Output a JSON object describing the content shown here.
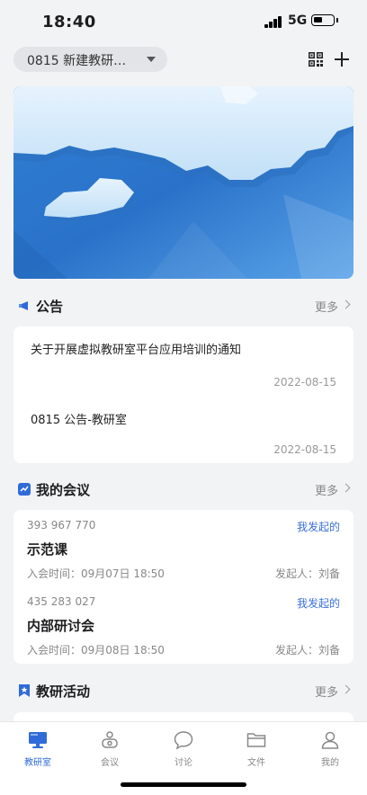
{
  "status_bar": {
    "time": "18:40",
    "network": "5G"
  },
  "header": {
    "room_name": "0815 新建教研…",
    "qr_icon": "qr-code-icon",
    "add_icon": "plus-icon"
  },
  "banner": {
    "image": "blue-hexagon-banner"
  },
  "announcements": {
    "title": "公告",
    "more": "更多",
    "items": [
      {
        "title": "关于开展虚拟教研室平台应用培训的通知",
        "date": "2022-08-15"
      },
      {
        "title": "0815 公告-教研室",
        "date": "2022-08-15"
      }
    ]
  },
  "meetings": {
    "title": "我的会议",
    "more": "更多",
    "items": [
      {
        "id": "393 967 770",
        "tag": "我发起的",
        "name": "示范课",
        "time": "入会时间：09月07日 18:50",
        "host": "发起人：刘备"
      },
      {
        "id": "435 283 027",
        "tag": "我发起的",
        "name": "内部研讨会",
        "time": "入会时间：09月08日 18:50",
        "host": "发起人：刘备"
      }
    ]
  },
  "activities": {
    "title": "教研活动",
    "more": "更多"
  },
  "tabbar": {
    "items": [
      {
        "label": "教研室",
        "active": true
      },
      {
        "label": "会议"
      },
      {
        "label": "讨论"
      },
      {
        "label": "文件"
      },
      {
        "label": "我的"
      }
    ]
  },
  "colors": {
    "accent": "#2f6bd9",
    "background": "#f2f3f5"
  }
}
